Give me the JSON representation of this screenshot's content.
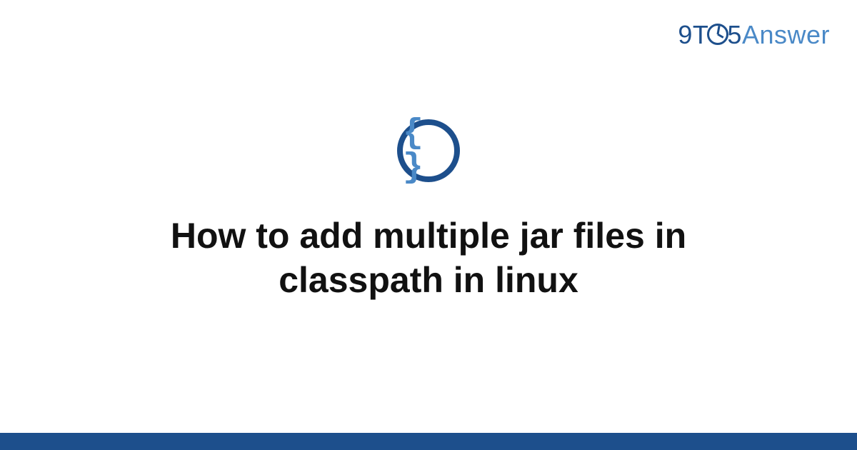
{
  "brand": {
    "part1": "9T",
    "part2": "5",
    "part3": "Answer"
  },
  "icon": {
    "symbol": "{ }"
  },
  "title": "How to add multiple jar files in classpath in linux",
  "colors": {
    "primary": "#1d4f8c",
    "accent": "#4a89c7"
  }
}
